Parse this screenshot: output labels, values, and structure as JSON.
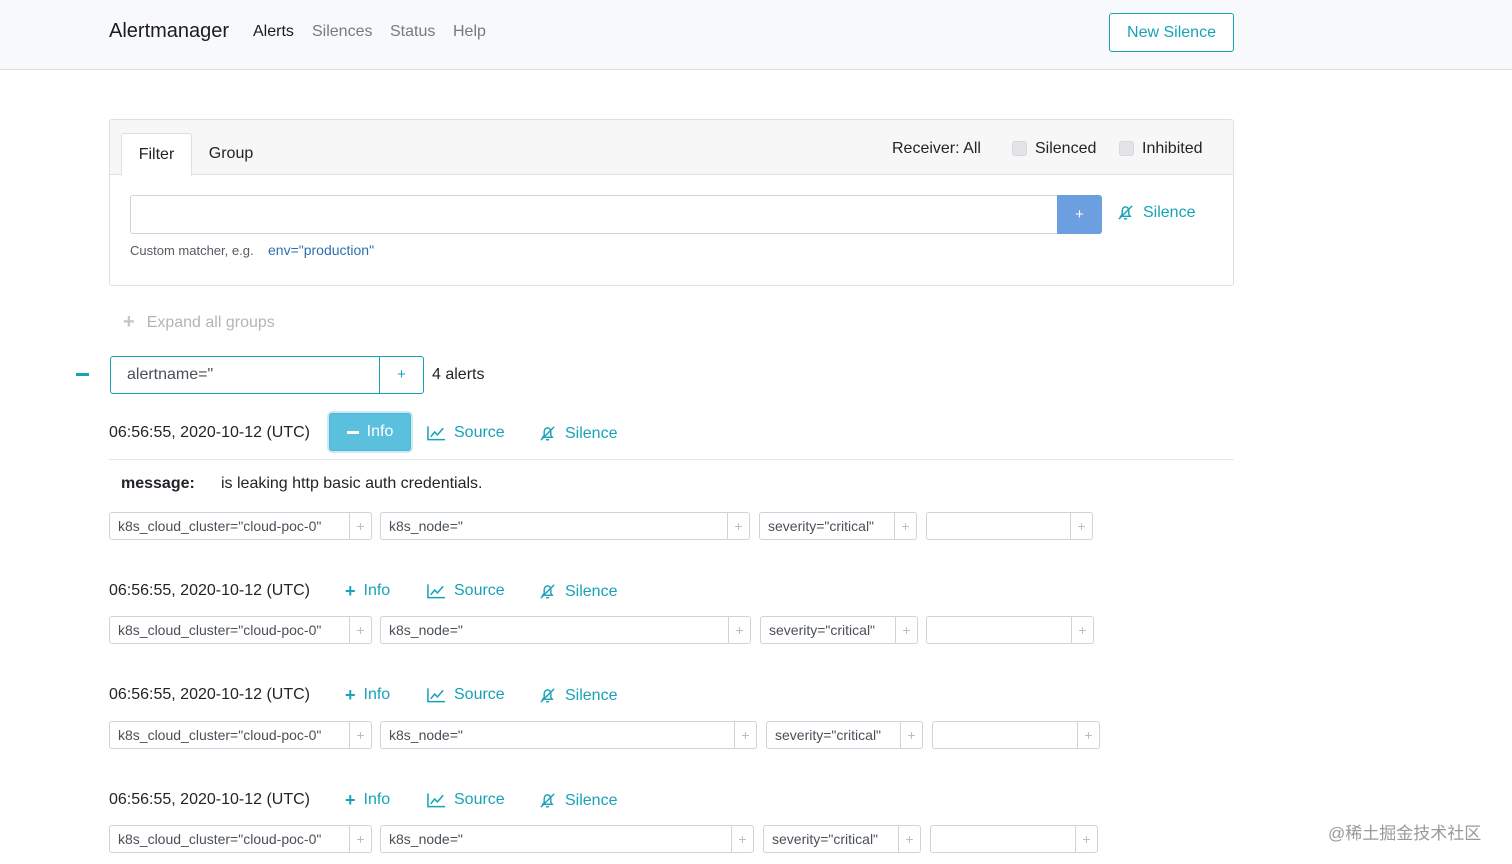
{
  "nav": {
    "brand": "Alertmanager",
    "links": [
      "Alerts",
      "Silences",
      "Status",
      "Help"
    ],
    "new_silence": "New Silence"
  },
  "filter_card": {
    "tabs": [
      "Filter",
      "Group"
    ],
    "receiver": "Receiver: All",
    "checkboxes": [
      "Silenced",
      "Inhibited"
    ],
    "input_value": "",
    "plus_label": "+",
    "silence_label": "Silence",
    "helper_text": "Custom matcher, e.g.",
    "helper_example": "env=\"production\""
  },
  "expand_all": "Expand all groups",
  "group": {
    "label": "alertname=\"",
    "plus_label": "+",
    "count": "4 alerts"
  },
  "actions": {
    "info": "Info",
    "source": "Source",
    "silence": "Silence"
  },
  "alerts": [
    {
      "time": "06:56:55, 2020-10-12 (UTC)",
      "expanded": true,
      "message_key": "message:",
      "message_value": "is leaking http basic auth credentials.",
      "labels": [
        "k8s_cloud_cluster=\"cloud-poc-0\"",
        "k8s_node=\"",
        "severity=\"critical\"",
        ""
      ]
    },
    {
      "time": "06:56:55, 2020-10-12 (UTC)",
      "expanded": false,
      "labels": [
        "k8s_cloud_cluster=\"cloud-poc-0\"",
        "k8s_node=\"",
        "severity=\"critical\"",
        ""
      ]
    },
    {
      "time": "06:56:55, 2020-10-12 (UTC)",
      "expanded": false,
      "labels": [
        "k8s_cloud_cluster=\"cloud-poc-0\"",
        "k8s_node=\"",
        "severity=\"critical\"",
        ""
      ]
    },
    {
      "time": "06:56:55, 2020-10-12 (UTC)",
      "expanded": false,
      "labels": [
        "k8s_cloud_cluster=\"cloud-poc-0\"",
        "k8s_node=\"",
        "severity=\"critical\"",
        ""
      ]
    }
  ],
  "watermark": "@稀土掘金技术社区",
  "colors": {
    "accent": "#17a2b8",
    "info_active": "#5bc0de",
    "filter_button": "#6c9fe0"
  }
}
